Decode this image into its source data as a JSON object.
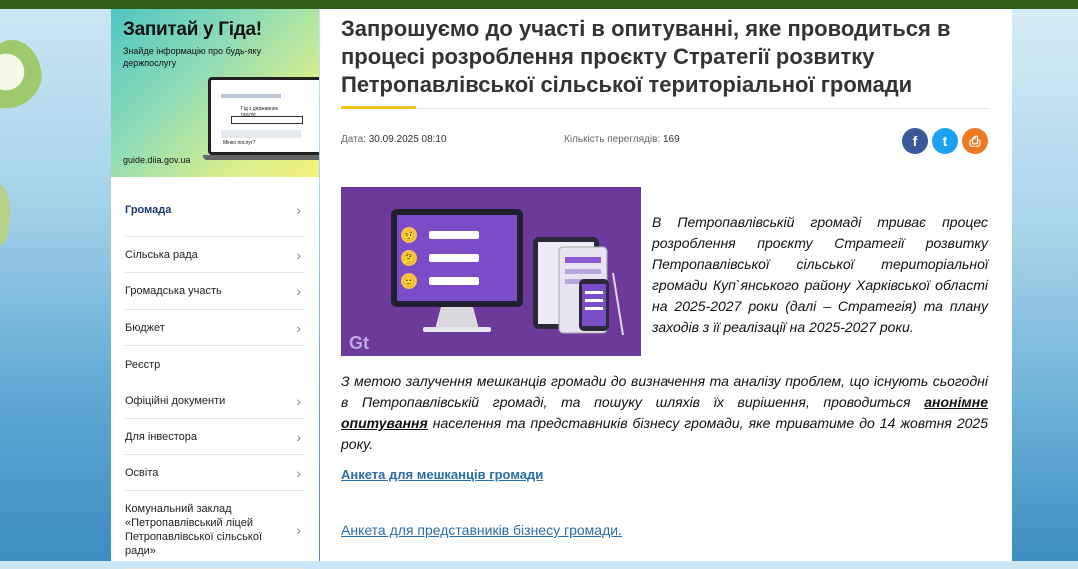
{
  "banner": {
    "title": "Запитай у Гіда!",
    "subtitle": "Знайде інформацію про будь-яку держпослугу",
    "url": "guide.diia.gov.ua",
    "screen_text": "Гід з державних послуг",
    "screen_field": "Мінко послуг?"
  },
  "menu": [
    {
      "label": "Громада",
      "active": true,
      "chevron": true
    },
    {
      "label": "Сільська рада",
      "active": false,
      "chevron": true
    },
    {
      "label": "Громадська участь",
      "active": false,
      "chevron": true
    },
    {
      "label": "Бюджет",
      "active": false,
      "chevron": true
    },
    {
      "label": "Реєстр",
      "active": false,
      "chevron": false
    },
    {
      "label": "Офіційні документи",
      "active": false,
      "chevron": true
    },
    {
      "label": "Для інвестора",
      "active": false,
      "chevron": true
    },
    {
      "label": "Освіта",
      "active": false,
      "chevron": true
    },
    {
      "label": "Комунальний заклад «Петропавлівський ліцей Петропавлівської сільської ради»",
      "active": false,
      "chevron": true
    }
  ],
  "article": {
    "title": "Запрошуємо до участі в опитуванні, яке проводиться в процесі розроблення проєкту Стратегії розвитку Петропавлівської сільської територіальної громади",
    "date_label": "Дата:",
    "date_value": "30.09.2025 08:10",
    "views_label": "Кількість переглядів:",
    "views_value": "169",
    "paragraph1": "В Петропавлівській громаді триває процес розроблення проєкту Стратегії розвитку Петропавлівської сільської територіальної громади Куп`янського району Харківської області на 2025-2027 роки (далі – Стратегія) та плану заходів з її реалізації на 2025-2027 роки.",
    "paragraph2_before": "З метою залучення мешканців громади до визначення та аналізу проблем, що існують сьогодні в Петропавлівській  громаді, та пошуку шляхів їх вирішення, проводиться ",
    "paragraph2_link": "анонімне опитування",
    "paragraph2_after": " населення та представників бізнесу громади, яке триватиме до 14 жовтня 2025 року.",
    "link_residents": "Анкета для мешканців громади ",
    "link_business": "Анкета для представників бізнесу громади."
  },
  "share": {
    "facebook_glyph": "f",
    "twitter_glyph": "t",
    "print_glyph": "⎙"
  },
  "hero": {
    "logo_text": "Gt",
    "emojis": [
      "🤨",
      "🤔",
      "🙂"
    ]
  },
  "colors": {
    "accent": "#f0c419",
    "link": "#2b6ea8",
    "active_menu": "#1a3c70",
    "hero_bg": "#6d3a9c"
  }
}
